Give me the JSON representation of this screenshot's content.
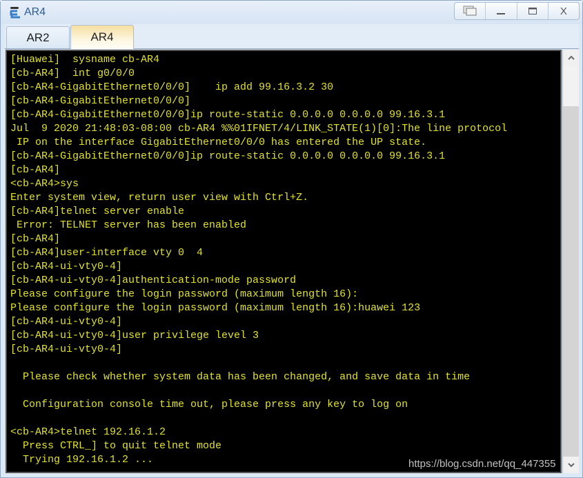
{
  "window": {
    "title": "AR4",
    "icon": "router-icon",
    "controls": {
      "restore_label": "⧉",
      "minimize_label": "—",
      "maximize_label": "▭",
      "close_label": "X"
    }
  },
  "tabs": [
    {
      "label": "AR2",
      "active": false
    },
    {
      "label": "AR4",
      "active": true
    }
  ],
  "terminal": {
    "lines": [
      "[Huawei]  sysname cb-AR4",
      "[cb-AR4]  int g0/0/0",
      "[cb-AR4-GigabitEthernet0/0/0]    ip add 99.16.3.2 30",
      "[cb-AR4-GigabitEthernet0/0/0]",
      "[cb-AR4-GigabitEthernet0/0/0]ip route-static 0.0.0.0 0.0.0.0 99.16.3.1",
      "Jul  9 2020 21:48:03-08:00 cb-AR4 %%01IFNET/4/LINK_STATE(1)[0]:The line protocol",
      " IP on the interface GigabitEthernet0/0/0 has entered the UP state.",
      "[cb-AR4-GigabitEthernet0/0/0]ip route-static 0.0.0.0 0.0.0.0 99.16.3.1",
      "[cb-AR4]",
      "<cb-AR4>sys",
      "Enter system view, return user view with Ctrl+Z.",
      "[cb-AR4]telnet server enable",
      " Error: TELNET server has been enabled",
      "[cb-AR4]",
      "[cb-AR4]user-interface vty 0  4",
      "[cb-AR4-ui-vty0-4]",
      "[cb-AR4-ui-vty0-4]authentication-mode password",
      "Please configure the login password (maximum length 16):",
      "Please configure the login password (maximum length 16):huawei 123",
      "[cb-AR4-ui-vty0-4]",
      "[cb-AR4-ui-vty0-4]user privilege level 3",
      "[cb-AR4-ui-vty0-4]",
      "",
      "  Please check whether system data has been changed, and save data in time",
      "",
      "  Configuration console time out, please press any key to log on",
      "",
      "<cb-AR4>telnet 192.16.1.2",
      "  Press CTRL_] to quit telnet mode",
      "  Trying 192.16.1.2 ..."
    ]
  },
  "scrollbar": {
    "up_label": "⌃",
    "down_label": "⌄"
  },
  "watermark": "https://blog.csdn.net/qq_447355"
}
